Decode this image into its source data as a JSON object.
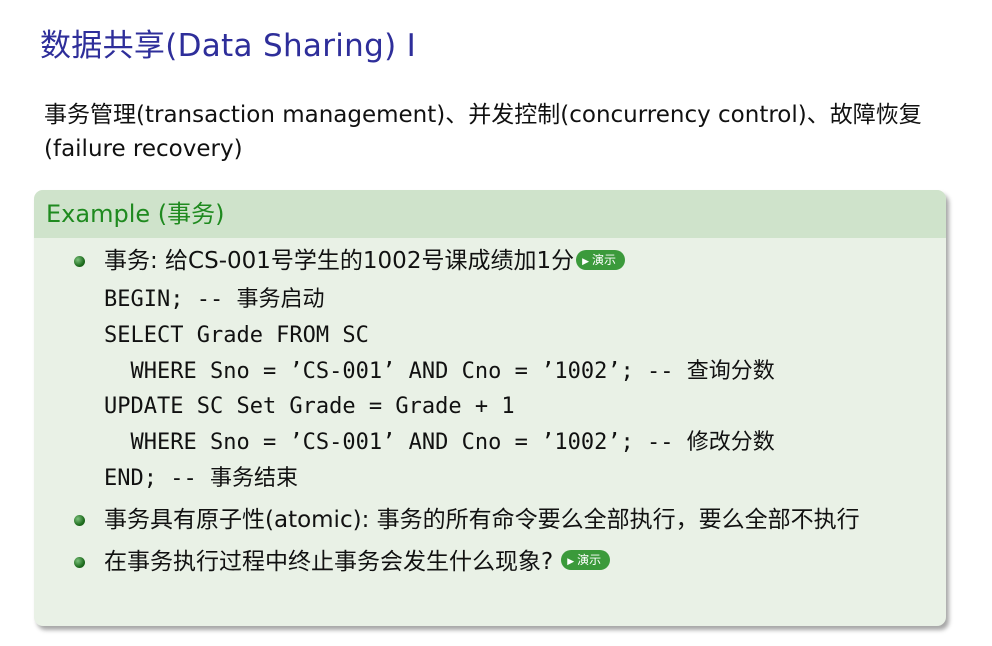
{
  "title": "数据共享(Data Sharing) I",
  "intro": "事务管理(transaction management)、并发控制(concurrency control)、故障恢复(failure recovery)",
  "block": {
    "header": "Example (事务)",
    "item1_text": "事务: 给CS-001号学生的1002号课成绩加1分",
    "demo_label": "演示",
    "code_lines": [
      "BEGIN; -- 事务启动",
      "SELECT Grade FROM SC",
      "  WHERE Sno = ’CS-001’ AND Cno = ’1002’; -- 查询分数",
      "UPDATE SC Set Grade = Grade + 1",
      "  WHERE Sno = ’CS-001’ AND Cno = ’1002’; -- 修改分数",
      "END; -- 事务结束"
    ],
    "item2_text": "事务具有原子性(atomic): 事务的所有命令要么全部执行，要么全部不执行",
    "item3_text": "在事务执行过程中终止事务会发生什么现象?"
  }
}
